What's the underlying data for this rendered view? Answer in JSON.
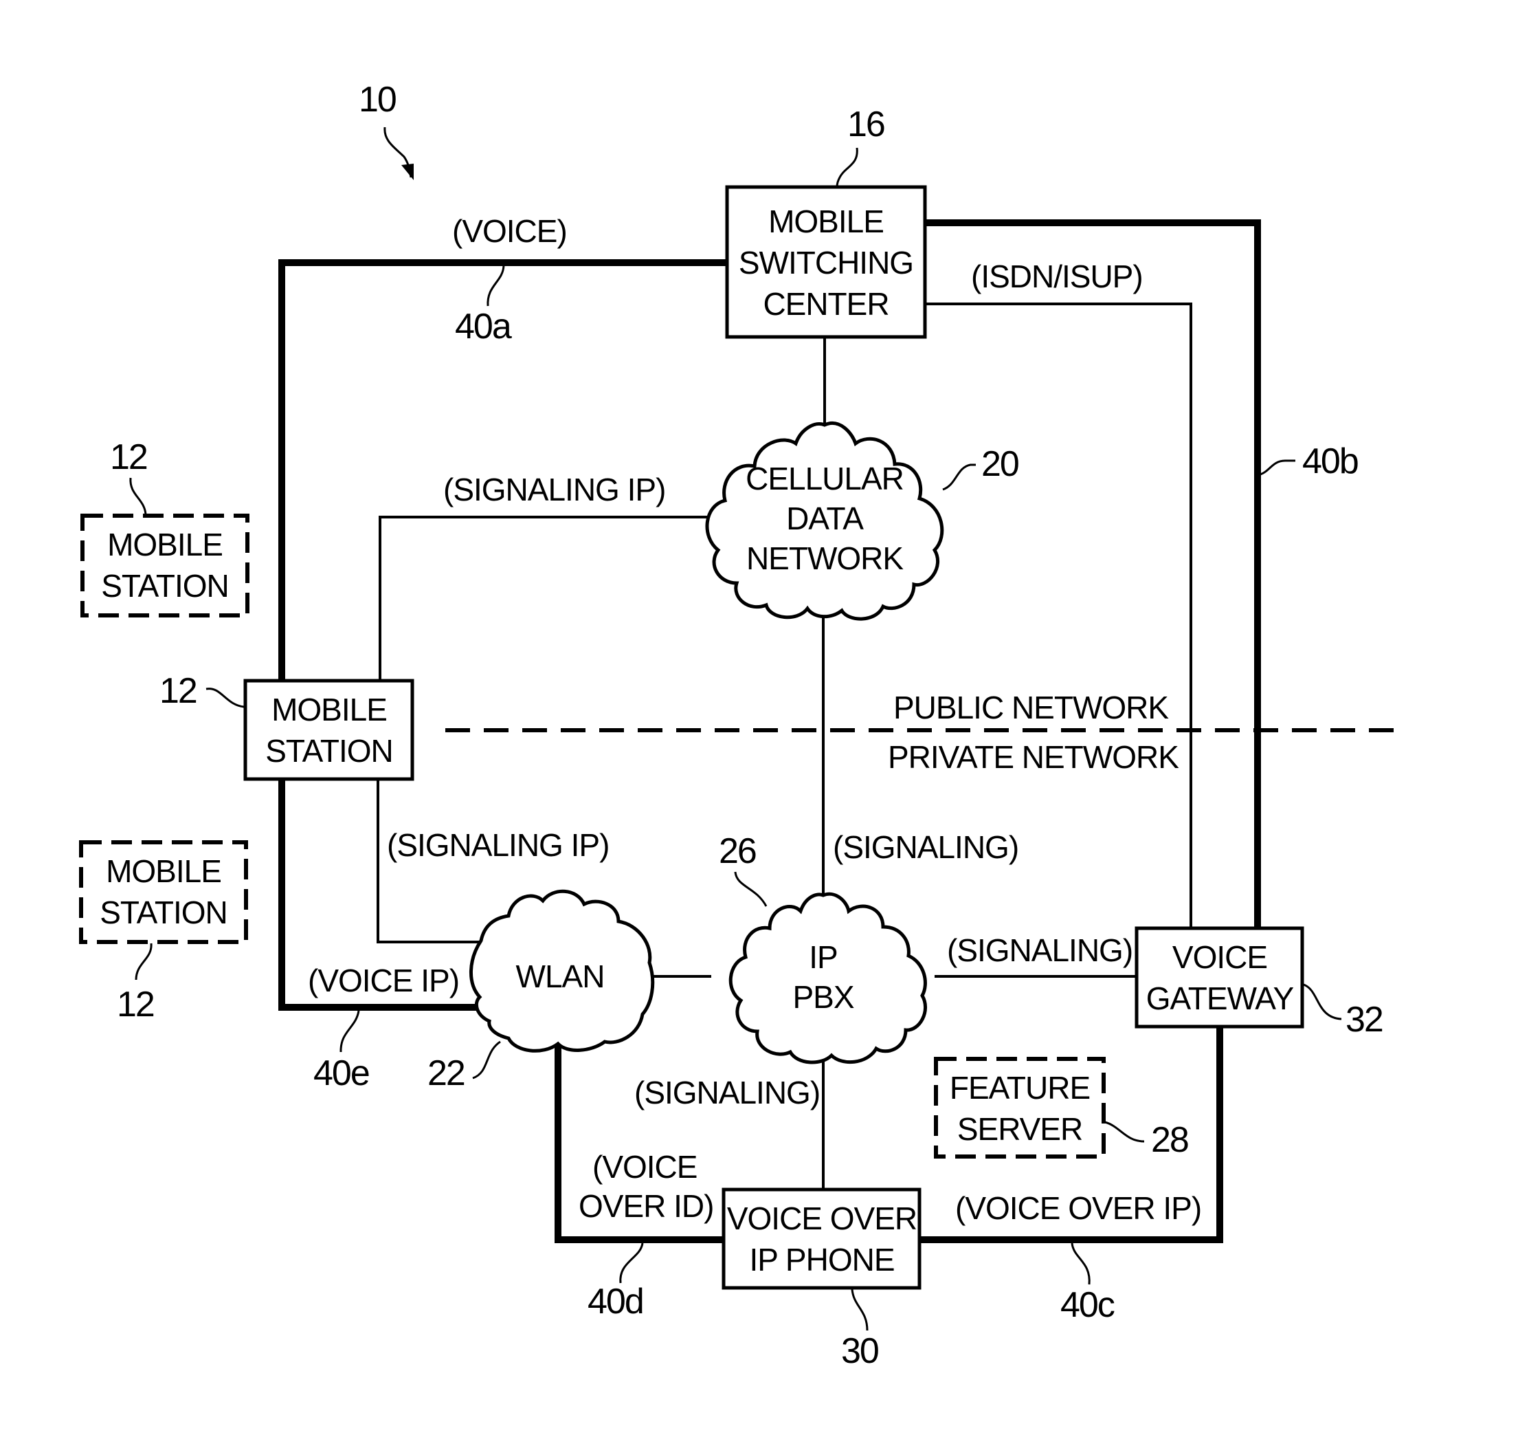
{
  "figure": {
    "ref": "10",
    "nodes": {
      "msc": {
        "ref": "16",
        "lines": [
          "MOBILE",
          "SWITCHING",
          "CENTER"
        ]
      },
      "cellular": {
        "ref": "20",
        "lines": [
          "CELLULAR",
          "DATA",
          "NETWORK"
        ]
      },
      "ms_main": {
        "ref": "12",
        "lines": [
          "MOBILE",
          "STATION"
        ]
      },
      "ms_top": {
        "ref": "12",
        "lines": [
          "MOBILE",
          "STATION"
        ]
      },
      "ms_bottom": {
        "ref": "12",
        "lines": [
          "MOBILE",
          "STATION"
        ]
      },
      "wlan": {
        "ref": "22",
        "lines": [
          "WLAN"
        ]
      },
      "pbx": {
        "ref": "26",
        "lines": [
          "IP",
          "PBX"
        ]
      },
      "gateway": {
        "ref": "32",
        "lines": [
          "VOICE",
          "GATEWAY"
        ]
      },
      "feature": {
        "ref": "28",
        "lines": [
          "FEATURE",
          "SERVER"
        ]
      },
      "phone": {
        "ref": "30",
        "lines": [
          "VOICE OVER",
          "IP PHONE"
        ]
      }
    },
    "links": {
      "l40a": {
        "ref": "40a",
        "label": "(VOICE)"
      },
      "l40b": {
        "ref": "40b"
      },
      "l40c": {
        "ref": "40c",
        "label": "(VOICE OVER IP)"
      },
      "l40d": {
        "ref": "40d",
        "label_lines": [
          "(VOICE",
          "OVER ID)"
        ]
      },
      "l40e": {
        "ref": "40e",
        "label": "(VOICE IP)"
      },
      "isdn": {
        "label": "(ISDN/ISUP)"
      },
      "sig_ip_top": {
        "label": "(SIGNALING IP)"
      },
      "sig_ip_bottom": {
        "label": "(SIGNALING IP)"
      },
      "sig_cell_pbx": {
        "label": "(SIGNALING)"
      },
      "sig_pbx_gw": {
        "label": "(SIGNALING)"
      },
      "sig_pbx_phone": {
        "label": "(SIGNALING)"
      }
    },
    "boundary": {
      "public": "PUBLIC NETWORK",
      "private": "PRIVATE NETWORK"
    }
  }
}
